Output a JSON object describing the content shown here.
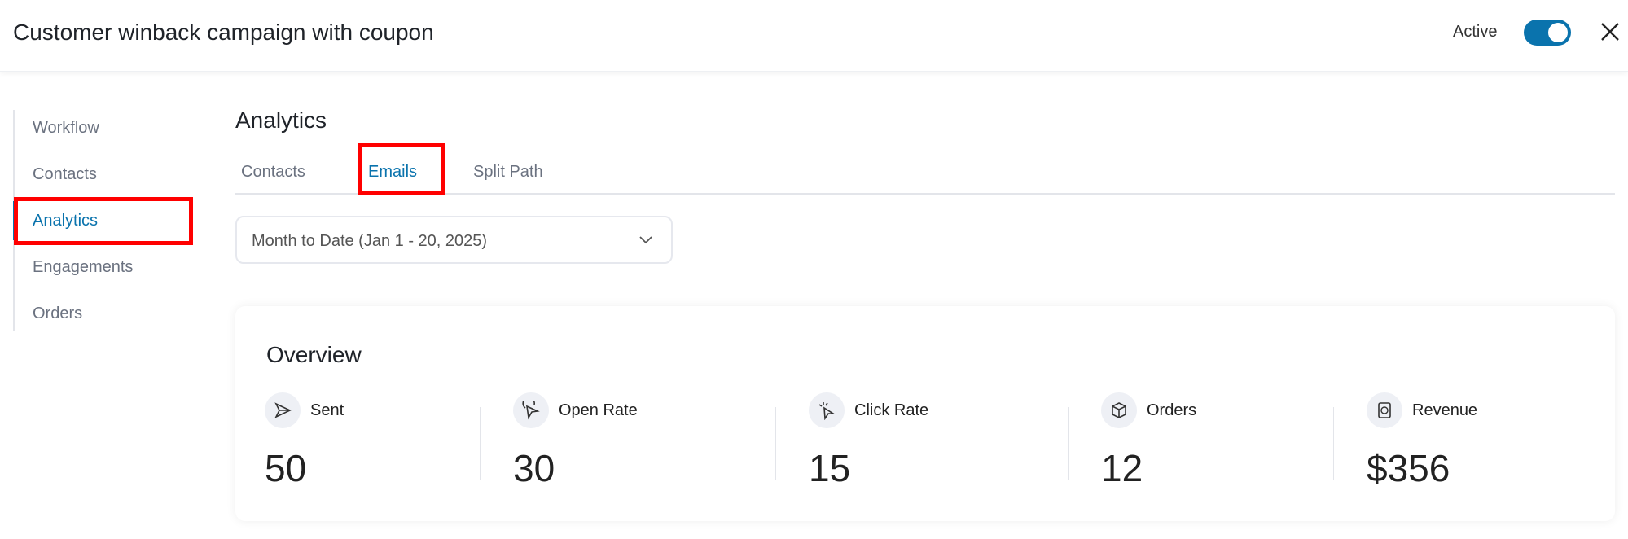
{
  "header": {
    "title": "Customer winback campaign with coupon",
    "status_label": "Active",
    "status_on": true
  },
  "sidebar": {
    "items": [
      {
        "label": "Workflow"
      },
      {
        "label": "Contacts"
      },
      {
        "label": "Analytics",
        "active": true
      },
      {
        "label": "Engagements"
      },
      {
        "label": "Orders"
      }
    ]
  },
  "main": {
    "title": "Analytics",
    "tabs": [
      {
        "label": "Contacts"
      },
      {
        "label": "Emails",
        "active": true
      },
      {
        "label": "Split Path"
      }
    ],
    "date_range": "Month to Date (Jan 1 - 20, 2025)",
    "overview": {
      "title": "Overview",
      "metrics": [
        {
          "label": "Sent",
          "value": "50",
          "icon": "send-icon"
        },
        {
          "label": "Open Rate",
          "value": "30",
          "icon": "cursor-open-icon"
        },
        {
          "label": "Click Rate",
          "value": "15",
          "icon": "click-icon"
        },
        {
          "label": "Orders",
          "value": "12",
          "icon": "box-icon"
        },
        {
          "label": "Revenue",
          "value": "$356",
          "icon": "revenue-icon"
        }
      ]
    }
  },
  "colors": {
    "accent": "#0a73ad",
    "highlight": "#ff0000"
  }
}
